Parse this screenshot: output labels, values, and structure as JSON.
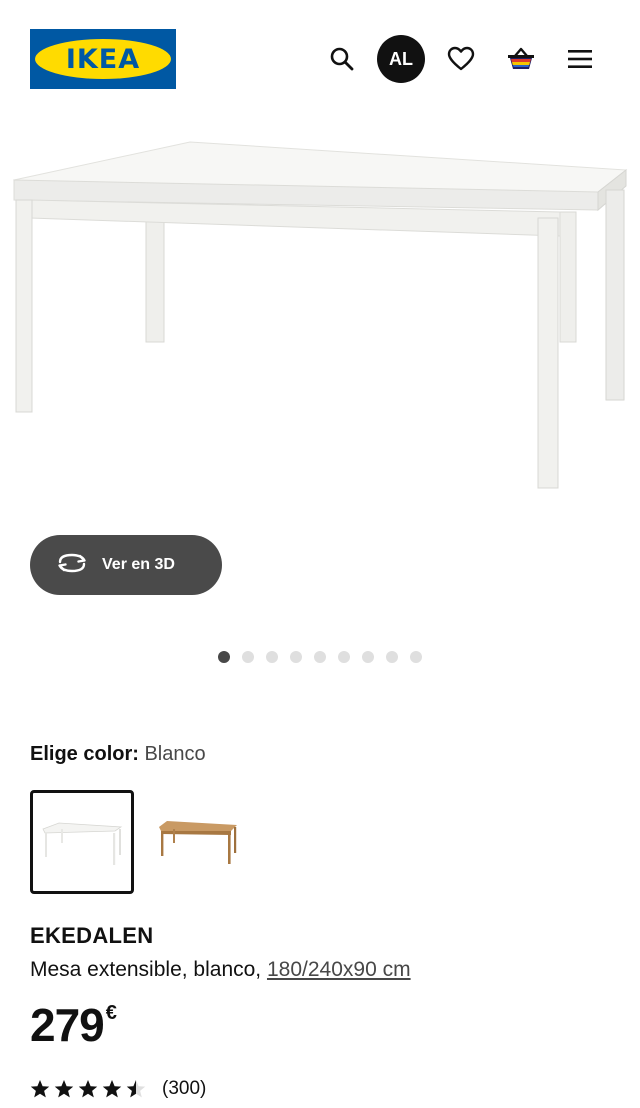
{
  "header": {
    "logo_text": "IKEA",
    "avatar_initials": "AL",
    "icons": [
      "search-icon",
      "heart-icon",
      "basket-icon",
      "menu-icon"
    ]
  },
  "gallery": {
    "view_3d_label": "Ver en 3D",
    "image_count": 9,
    "active_index": 0
  },
  "color": {
    "label": "Elige color:",
    "value": "Blanco",
    "options": [
      {
        "name": "white",
        "color": "#f4f4f2",
        "selected": true
      },
      {
        "name": "oak",
        "color": "#b98a55",
        "selected": false
      }
    ]
  },
  "product": {
    "name": "EKEDALEN",
    "description": "Mesa extensible, blanco,",
    "size": "180/240x90 cm",
    "price": "279",
    "currency": "€",
    "rating": 4.5,
    "reviews": "(300)"
  },
  "colors": {
    "logo_blue": "#0058a3",
    "logo_yellow": "#ffdb00",
    "button_dark": "#4a4a4a"
  }
}
